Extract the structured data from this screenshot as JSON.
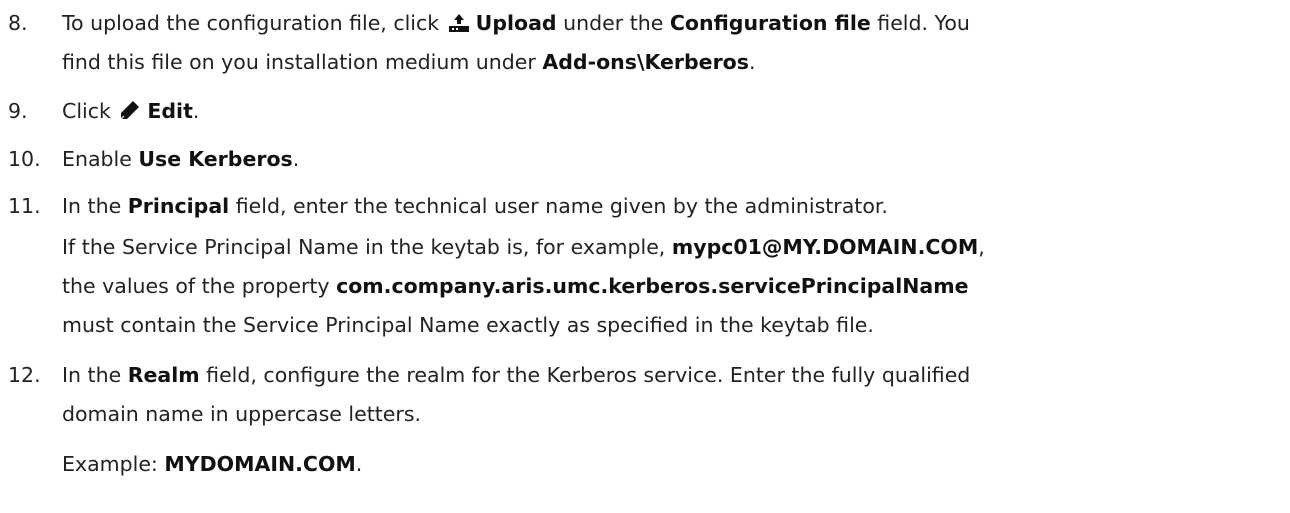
{
  "steps": [
    {
      "number": "8.",
      "lines": [
        {
          "t1": "To upload the configuration file, click ",
          "icon": "upload-icon",
          "b1": "Upload",
          "t2": " under the ",
          "b2": "Configuration file",
          "t3": " field. You"
        },
        {
          "t1": "find this file on you installation medium under ",
          "b1": "Add-ons\\Kerberos",
          "t2": "."
        }
      ]
    },
    {
      "number": "9.",
      "t1": "Click ",
      "icon": "pencil-icon",
      "b1": "Edit",
      "t2": "."
    },
    {
      "number": "10.",
      "t1": "Enable ",
      "b1": "Use Kerberos",
      "t2": "."
    },
    {
      "number": "11.",
      "t1": "In the ",
      "b1": "Principal",
      "t2": " field, enter the technical user name given by the administrator.",
      "note": [
        {
          "t1": "If the Service Principal Name in the keytab is, for example, ",
          "b1": "mypc01@MY.DOMAIN.COM",
          "t2": ","
        },
        {
          "t1": "the values of the property ",
          "b1": "com.company.aris.umc.kerberos.servicePrincipalName"
        },
        {
          "t1": "must contain the Service Principal Name exactly as specified in the keytab file."
        }
      ]
    },
    {
      "number": "12.",
      "lines": [
        {
          "t1": "In the ",
          "b1": "Realm",
          "t2": " field, configure the realm for the Kerberos service. Enter the fully qualified"
        },
        {
          "t1": "domain name in uppercase letters."
        }
      ],
      "example": {
        "t1": "Example: ",
        "b1": "MYDOMAIN.COM",
        "t2": "."
      }
    }
  ]
}
